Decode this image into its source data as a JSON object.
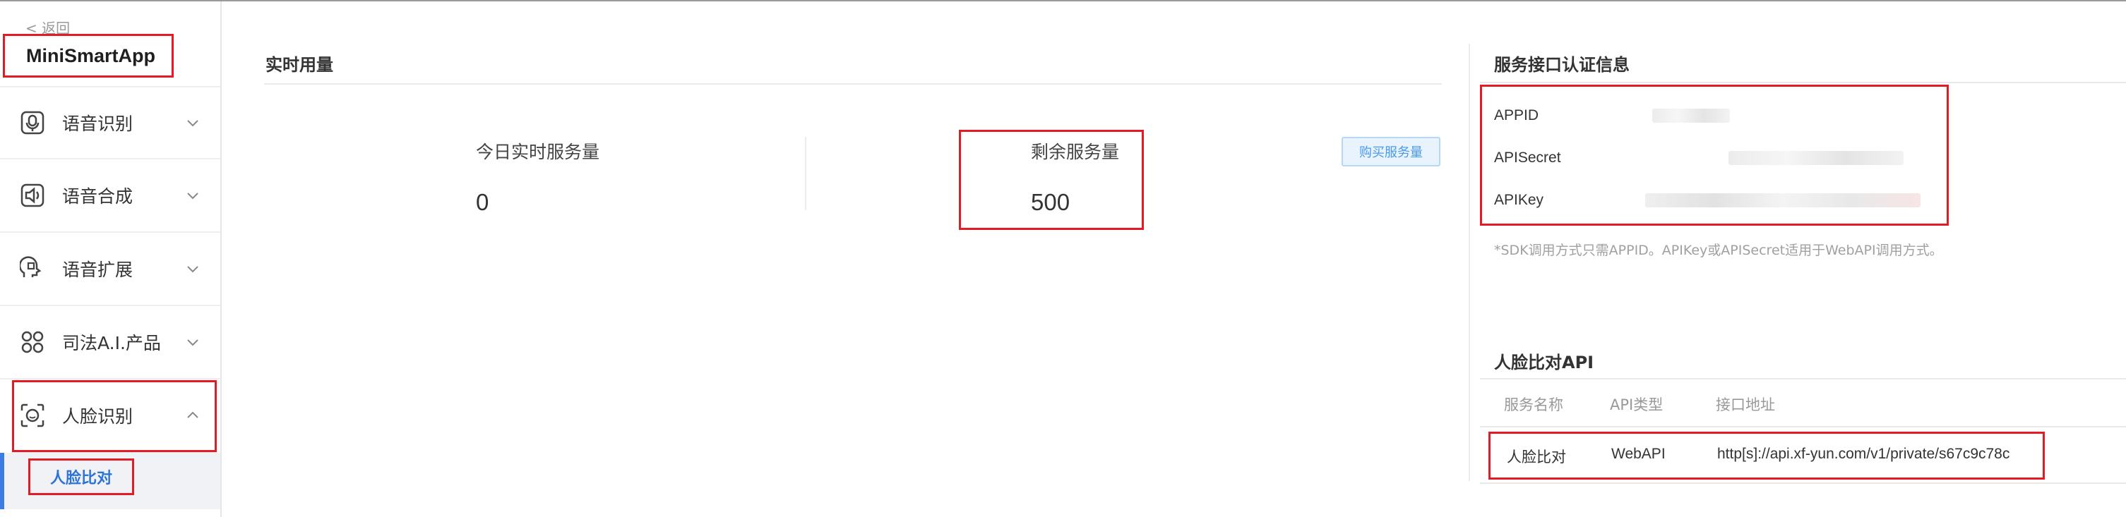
{
  "sidebar": {
    "back_label": "< 返回",
    "app_name": "MiniSmartApp",
    "items": [
      {
        "label": "语音识别",
        "icon": "microphone-icon",
        "expanded": false
      },
      {
        "label": "语音合成",
        "icon": "speaker-icon",
        "expanded": false
      },
      {
        "label": "语音扩展",
        "icon": "voice-extension-icon",
        "expanded": false
      },
      {
        "label": "司法A.I.产品",
        "icon": "justice-icon",
        "expanded": false
      },
      {
        "label": "人脸识别",
        "icon": "face-scan-icon",
        "expanded": true
      }
    ],
    "active_sub": "人脸比对"
  },
  "usage": {
    "title": "实时用量",
    "today_label": "今日实时服务量",
    "today_value": "0",
    "remain_label": "剩余服务量",
    "remain_value": "500",
    "buy_button": "购买服务量"
  },
  "auth": {
    "title": "服务接口认证信息",
    "rows": [
      {
        "label": "APPID"
      },
      {
        "label": "APISecret"
      },
      {
        "label": "APIKey"
      }
    ],
    "note": "*SDK调用方式只需APPID。APIKey或APISecret适用于WebAPI调用方式。"
  },
  "face_api": {
    "title": "人脸比对API",
    "headers": [
      "服务名称",
      "API类型",
      "接口地址"
    ],
    "rows": [
      {
        "name": "人脸比对",
        "type": "WebAPI",
        "url": "http[s]://api.xf-yun.com/v1/private/s67c9c78c"
      }
    ]
  },
  "colors": {
    "highlight_box": "#e21b24",
    "accent_blue": "#2d74d6",
    "button_bg": "#e9f3fd"
  }
}
